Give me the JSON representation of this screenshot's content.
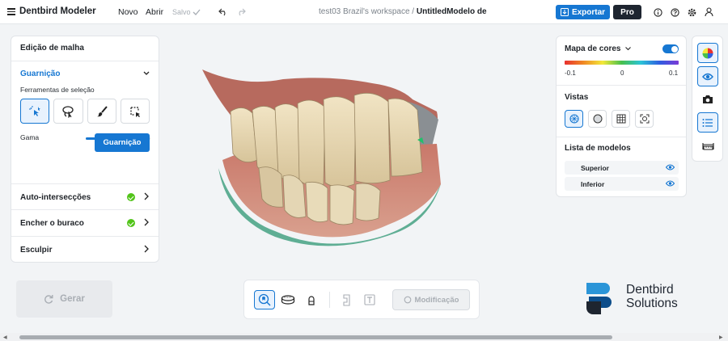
{
  "header": {
    "app_title": "Dentbird Modeler",
    "menu_new": "Novo",
    "menu_open": "Abrir",
    "save_status": "Salvo",
    "workspace_prefix": "test03 Brazil's workspace /",
    "workspace_file": "UntitledModelo de",
    "export_label": "Exportar",
    "pro_label": "Pro"
  },
  "left_panel": {
    "title": "Edição de malha",
    "guarnicao_header": "Guarnição",
    "selection_tools_label": "Ferramentas de seleção",
    "gama_label": "Gama",
    "gama_value": 0.5,
    "guarnicao_button": "Guarnição",
    "rows": [
      {
        "label": "Auto-intersecções",
        "done": true
      },
      {
        "label": "Encher o buraco",
        "done": true
      },
      {
        "label": "Esculpir",
        "done": false
      }
    ]
  },
  "gerar_label": "Gerar",
  "bottom_toolbar": {
    "modificacao_label": "Modificação"
  },
  "right_panel": {
    "color_map_label": "Mapa de cores",
    "color_map_enabled": true,
    "scale_min": "-0.1",
    "scale_mid": "0",
    "scale_max": "0.1",
    "views_label": "Vistas",
    "models_label": "Lista de modelos",
    "models": [
      {
        "name": "Superior",
        "visible": true
      },
      {
        "name": "Inferior",
        "visible": true
      }
    ]
  },
  "logo": {
    "line1": "Dentbird",
    "line2": "Solutions"
  },
  "colors": {
    "accent": "#1677d2",
    "dark": "#1e2530",
    "success": "#52c41a"
  }
}
